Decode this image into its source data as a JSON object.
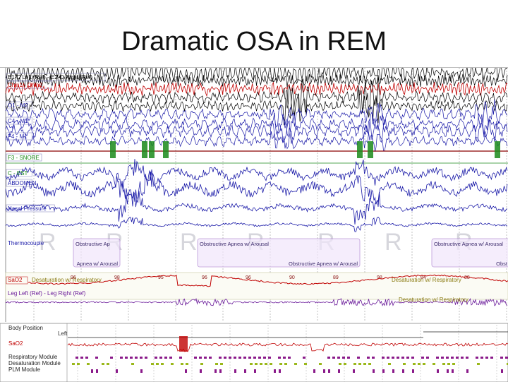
{
  "slide": {
    "title": "Dramatic OSA in REM"
  },
  "channels": [
    {
      "label": "E1-C Left (Ref) - E2-C Right (Ref)",
      "color": "#000000"
    },
    {
      "label": "Chin1 - Chin2",
      "color": "#c00000"
    },
    {
      "label": "O1 - M2",
      "color": "#1a1aa8"
    },
    {
      "label": "C4 - M1",
      "color": "#1a1aa8"
    },
    {
      "label": "F4 - M1",
      "color": "#1a1aa8"
    },
    {
      "label": "F3 - SNORE",
      "color": "#1a8a1a"
    },
    {
      "label": "C - ECG",
      "color": "#8a0000"
    },
    {
      "label": "C - EST",
      "color": "#1a8a1a"
    },
    {
      "label": "Th",
      "color": "#1a1aa8"
    },
    {
      "label": "ABDOMEN",
      "color": "#1a1aa8"
    },
    {
      "label": "Nasal Pressure",
      "color": "#1a1aa8"
    },
    {
      "label": "Thermocouple",
      "color": "#1a1aa8"
    }
  ],
  "events": [
    {
      "label": "Obstructive Ap",
      "sub": "Apnea w/ Arousal"
    },
    {
      "label": "Obstructive Apnea w/ Arousal",
      "sub": "Obstructive Apnea w/ Arousal"
    },
    {
      "label": "Obstructive Apnea w/ Arousal",
      "sub": "Obst"
    }
  ],
  "spo2": {
    "channel_label": "SaO2",
    "event_label": "Desaturation w/ Respiratory",
    "values": [
      "96",
      "98",
      "95",
      "96",
      "96",
      "90",
      "89",
      "98",
      "84",
      "88",
      "90"
    ]
  },
  "lower_channels": [
    {
      "label": "Leg Left (Ref) - Leg Right (Ref)",
      "color": "#6a1a9a"
    },
    {
      "label": "Desaturation w/ Respiratory",
      "color": "#b0b020"
    }
  ],
  "overview": {
    "rows": [
      "Body Position",
      "SaO2",
      "Respiratory Module",
      "Desaturation Module",
      "PLM Module"
    ],
    "position_marker": "Left"
  },
  "stage_ghost_letters": [
    "R",
    "R",
    "R",
    "R",
    "R",
    "R",
    "R"
  ],
  "accent_colors": {
    "eeg": "#1a1aa8",
    "eog": "#000000",
    "emg": "#c00000",
    "snore": "#1a8a1a",
    "event_box": "#a070c8",
    "spo2": "#c00000"
  }
}
